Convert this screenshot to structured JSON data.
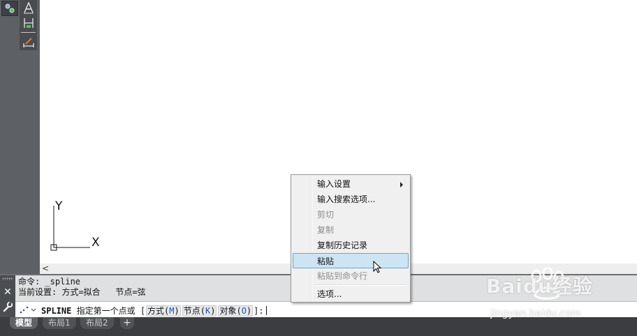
{
  "canvas": {
    "ucs_y_label": "Y",
    "ucs_x_label": "X",
    "scroll_left_glyph": "<"
  },
  "command_history": [
    "命令: _spline",
    "当前设置: 方式=拟合   节点=弦"
  ],
  "command_line": {
    "command": "SPLINE",
    "prompt_text": "指定第一个点或 [",
    "options": [
      {
        "label": "方式(",
        "key": "M",
        "close": ")"
      },
      {
        "label": "节点(",
        "key": "K",
        "close": ")"
      },
      {
        "label": "对象(",
        "key": "O",
        "close": ")"
      }
    ],
    "prompt_end": "]:"
  },
  "command_bar": {
    "close_glyph": "✕"
  },
  "layout_tabs": {
    "tabs": [
      "模型",
      "布局1",
      "布局2"
    ],
    "active": "模型",
    "add_glyph": "+"
  },
  "context_menu": {
    "items": [
      {
        "label": "输入设置",
        "enabled": true,
        "submenu": true
      },
      {
        "label": "输入搜索选项...",
        "enabled": true
      },
      {
        "label": "剪切",
        "enabled": false
      },
      {
        "label": "复制",
        "enabled": false
      },
      {
        "label": "复制历史记录",
        "enabled": true
      },
      {
        "label": "粘贴",
        "enabled": true,
        "highlighted": true
      },
      {
        "label": "粘贴到命令行",
        "enabled": false
      },
      {
        "label": "选项...",
        "enabled": true
      }
    ]
  },
  "watermark": {
    "brand": "Baidu经验",
    "url": "jingyan.baidu.com"
  }
}
